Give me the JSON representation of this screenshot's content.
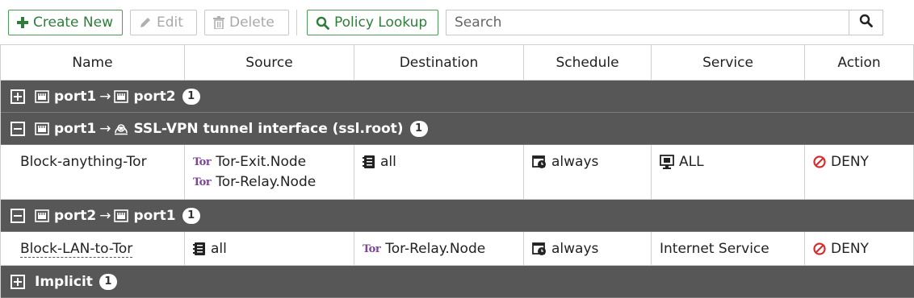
{
  "toolbar": {
    "create_new": "Create New",
    "edit": "Edit",
    "delete": "Delete",
    "policy_lookup": "Policy Lookup",
    "search_placeholder": "Search"
  },
  "columns": [
    "Name",
    "Source",
    "Destination",
    "Schedule",
    "Service",
    "Action"
  ],
  "groups": [
    {
      "from": "port1",
      "to": "port2",
      "count": "1",
      "expanded": false
    },
    {
      "from": "port1",
      "to": "SSL-VPN tunnel interface (ssl.root)",
      "count": "1",
      "expanded": true,
      "rows": [
        {
          "name": "Block-anything-Tor",
          "source": [
            "Tor-Exit.Node",
            "Tor-Relay.Node"
          ],
          "destination": "all",
          "schedule": "always",
          "service": "ALL",
          "action": "DENY"
        }
      ]
    },
    {
      "from": "port2",
      "to": "port1",
      "count": "1",
      "expanded": true,
      "rows": [
        {
          "name": "Block-LAN-to-Tor",
          "source": [
            "all"
          ],
          "destination": "Tor-Relay.Node",
          "schedule": "always",
          "service": "Internet Service",
          "action": "DENY"
        }
      ]
    },
    {
      "label": "Implicit",
      "count": "1",
      "expanded": false
    }
  ],
  "tor_badge": "Tor",
  "colors": {
    "accent_green": "#2f7d3a",
    "group_header": "#575757",
    "deny_red": "#d32f2f",
    "tor_purple": "#7d4698"
  },
  "icons": [
    "plus-icon",
    "pencil-icon",
    "trash-icon",
    "magnifier-icon",
    "expand-icon",
    "collapse-icon",
    "interface-port-icon",
    "ssl-vpn-icon",
    "address-icon",
    "schedule-icon",
    "service-icon",
    "deny-icon"
  ]
}
